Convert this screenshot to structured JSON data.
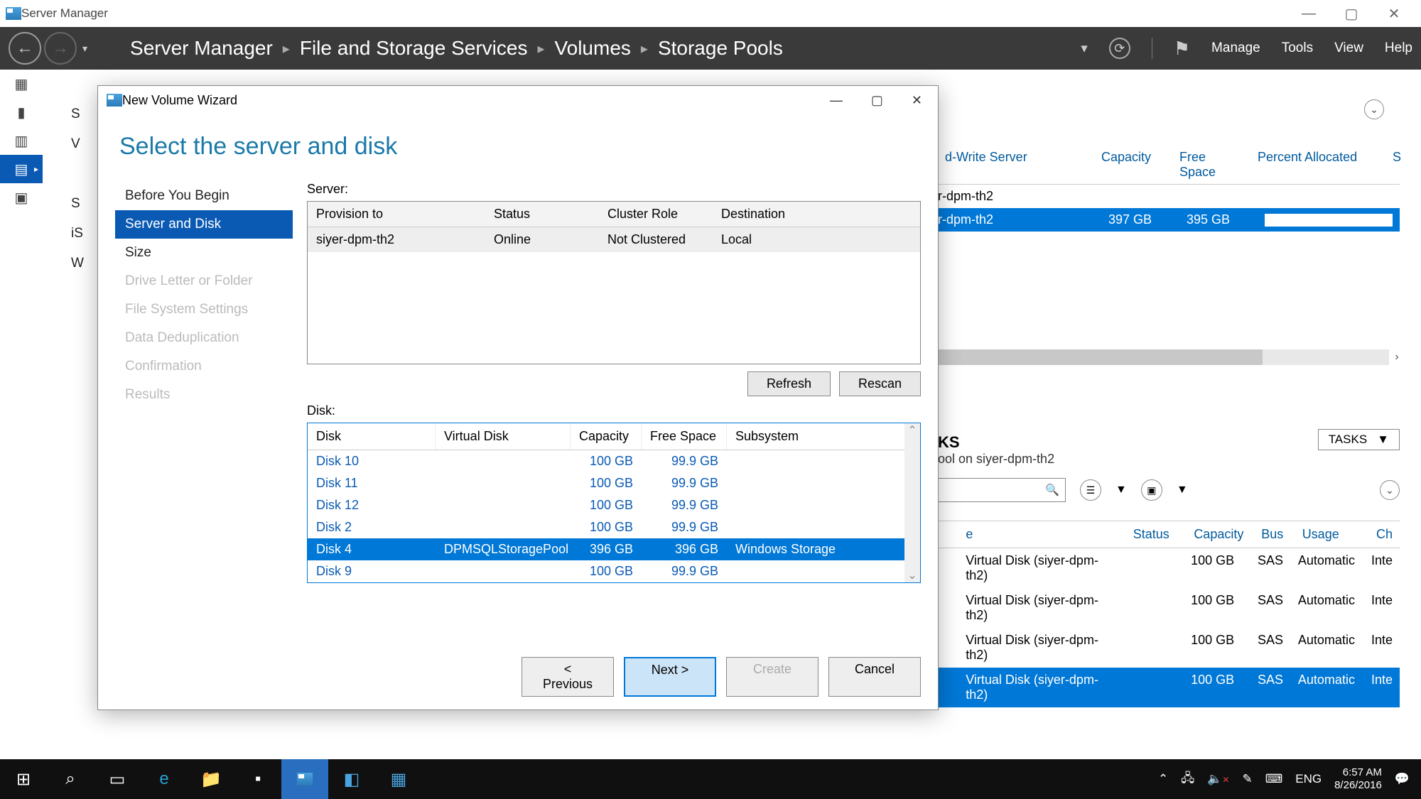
{
  "window": {
    "title": "Server Manager"
  },
  "ribbon": {
    "breadcrumbs": [
      "Server Manager",
      "File and Storage Services",
      "Volumes",
      "Storage Pools"
    ],
    "menu": {
      "manage": "Manage",
      "tools": "Tools",
      "view": "View",
      "help": "Help"
    }
  },
  "peek_items": [
    "S",
    "V",
    "",
    "S",
    "iS",
    "W"
  ],
  "pools_panel": {
    "cols": {
      "rw": "d-Write Server",
      "cap": "Capacity",
      "free": "Free Space",
      "pct": "Percent Allocated",
      "s": "S"
    },
    "group": "r-dpm-th2",
    "row": {
      "rw": "r-dpm-th2",
      "cap": "397 GB",
      "free": "395 GB"
    }
  },
  "disks_panel": {
    "header_suffix": "KS",
    "subtitle": "ool on siyer-dpm-th2",
    "tasks_btn": "TASKS",
    "cols": {
      "e": "e",
      "status": "Status",
      "cap": "Capacity",
      "bus": "Bus",
      "usage": "Usage",
      "ch": "Ch"
    },
    "rows": [
      {
        "e": "Virtual Disk (siyer-dpm-th2)",
        "cap": "100 GB",
        "bus": "SAS",
        "usage": "Automatic",
        "ch": "Inte",
        "sel": false
      },
      {
        "e": "Virtual Disk (siyer-dpm-th2)",
        "cap": "100 GB",
        "bus": "SAS",
        "usage": "Automatic",
        "ch": "Inte",
        "sel": false
      },
      {
        "e": "Virtual Disk (siyer-dpm-th2)",
        "cap": "100 GB",
        "bus": "SAS",
        "usage": "Automatic",
        "ch": "Inte",
        "sel": false
      },
      {
        "e": "Virtual Disk (siyer-dpm-th2)",
        "cap": "100 GB",
        "bus": "SAS",
        "usage": "Automatic",
        "ch": "Inte",
        "sel": true
      }
    ]
  },
  "dialog": {
    "title": "New Volume Wizard",
    "heading": "Select the server and disk",
    "steps": [
      {
        "label": "Before You Begin",
        "state": "done"
      },
      {
        "label": "Server and Disk",
        "state": "active"
      },
      {
        "label": "Size",
        "state": "done"
      },
      {
        "label": "Drive Letter or Folder",
        "state": "pending"
      },
      {
        "label": "File System Settings",
        "state": "pending"
      },
      {
        "label": "Data Deduplication",
        "state": "pending"
      },
      {
        "label": "Confirmation",
        "state": "pending"
      },
      {
        "label": "Results",
        "state": "pending"
      }
    ],
    "server_label": "Server:",
    "server_cols": {
      "p": "Provision to",
      "s": "Status",
      "c": "Cluster Role",
      "d": "Destination"
    },
    "server_row": {
      "p": "siyer-dpm-th2",
      "s": "Online",
      "c": "Not Clustered",
      "d": "Local"
    },
    "refresh_btn": "Refresh",
    "rescan_btn": "Rescan",
    "disk_label": "Disk:",
    "disk_cols": {
      "d": "Disk",
      "v": "Virtual Disk",
      "c": "Capacity",
      "f": "Free Space",
      "s": "Subsystem"
    },
    "disk_rows": [
      {
        "d": "Disk 10",
        "v": "",
        "c": "100 GB",
        "f": "99.9 GB",
        "s": "",
        "sel": false
      },
      {
        "d": "Disk 11",
        "v": "",
        "c": "100 GB",
        "f": "99.9 GB",
        "s": "",
        "sel": false
      },
      {
        "d": "Disk 12",
        "v": "",
        "c": "100 GB",
        "f": "99.9 GB",
        "s": "",
        "sel": false
      },
      {
        "d": "Disk 2",
        "v": "",
        "c": "100 GB",
        "f": "99.9 GB",
        "s": "",
        "sel": false
      },
      {
        "d": "Disk 4",
        "v": "DPMSQLStoragePool",
        "c": "396 GB",
        "f": "396 GB",
        "s": "Windows Storage",
        "sel": true
      },
      {
        "d": "Disk 9",
        "v": "",
        "c": "100 GB",
        "f": "99.9 GB",
        "s": "",
        "sel": false
      }
    ],
    "footer": {
      "prev": "< Previous",
      "next": "Next >",
      "create": "Create",
      "cancel": "Cancel"
    }
  },
  "taskbar": {
    "lang": "ENG",
    "time": "6:57 AM",
    "date": "8/26/2016"
  }
}
